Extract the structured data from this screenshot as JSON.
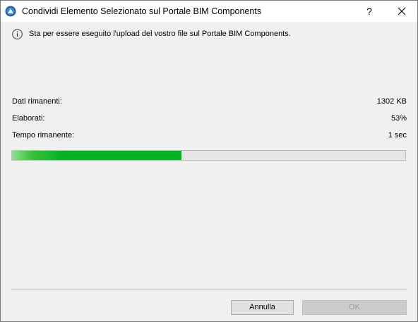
{
  "window": {
    "title": "Condividi Elemento Selezionato sul Portale BIM Components",
    "help_label": "?"
  },
  "info": {
    "message": "Sta per essere eseguito l'upload del vostro file sul Portale BIM Components."
  },
  "stats": [
    {
      "label": "Dati rimanenti:",
      "value": "1302 KB"
    },
    {
      "label": "Elaborati:",
      "value": "53%"
    },
    {
      "label": "Tempo rimanente:",
      "value": "1 sec"
    }
  ],
  "progress": {
    "fraction": 0.43,
    "color": "#06b025"
  },
  "buttons": {
    "cancel_label": "Annulla",
    "ok_label": "OK"
  },
  "icons": {
    "app": "archicad-app-icon",
    "info": "info-icon",
    "close": "close-icon"
  }
}
